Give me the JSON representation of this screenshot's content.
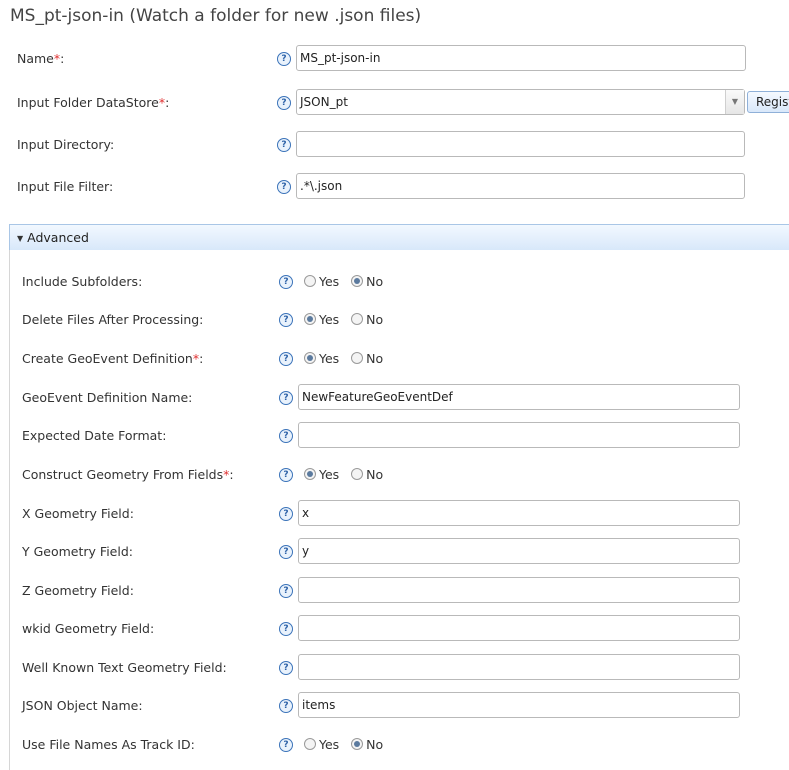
{
  "window": {
    "title": "MS_pt-json-in (Watch a folder for new .json files)"
  },
  "help_glyph": "?",
  "top_fields": {
    "name": {
      "label": "Name",
      "value": "MS_pt-json-in"
    },
    "folder": {
      "label": "Input Folder DataStore",
      "value": "JSON_pt",
      "register_label": "Register"
    },
    "directory": {
      "label": "Input Directory:",
      "value": ""
    },
    "filter": {
      "label": "Input File Filter:",
      "value": ".*\\.json"
    }
  },
  "advanced": {
    "label": "Advanced",
    "include_subfolders": {
      "label": "Include Subfolders:",
      "yes": "Yes",
      "no": "No",
      "selected": "No"
    },
    "delete_files": {
      "label": "Delete Files After Processing:",
      "yes": "Yes",
      "no": "No",
      "selected": "Yes"
    },
    "create_def": {
      "label": "Create GeoEvent Definition",
      "yes": "Yes",
      "no": "No",
      "selected": "Yes"
    },
    "def_name": {
      "label": "GeoEvent Definition Name:",
      "value": "NewFeatureGeoEventDef"
    },
    "date_format": {
      "label": "Expected Date Format:",
      "value": ""
    },
    "construct_geometry": {
      "label": "Construct Geometry From Fields",
      "yes": "Yes",
      "no": "No",
      "selected": "Yes"
    },
    "x_field": {
      "label": "X Geometry Field:",
      "value": "x"
    },
    "y_field": {
      "label": "Y Geometry Field:",
      "value": "y"
    },
    "z_field": {
      "label": "Z Geometry Field:",
      "value": ""
    },
    "wkid_field": {
      "label": "wkid Geometry Field:",
      "value": ""
    },
    "wkt_field": {
      "label": "Well Known Text Geometry Field:",
      "value": ""
    },
    "json_object": {
      "label": "JSON Object Name:",
      "value": "items"
    },
    "track_id": {
      "label": "Use File Names As Track ID:",
      "yes": "Yes",
      "no": "No",
      "selected": "No"
    }
  },
  "required_mark": "*",
  "colon": ":"
}
